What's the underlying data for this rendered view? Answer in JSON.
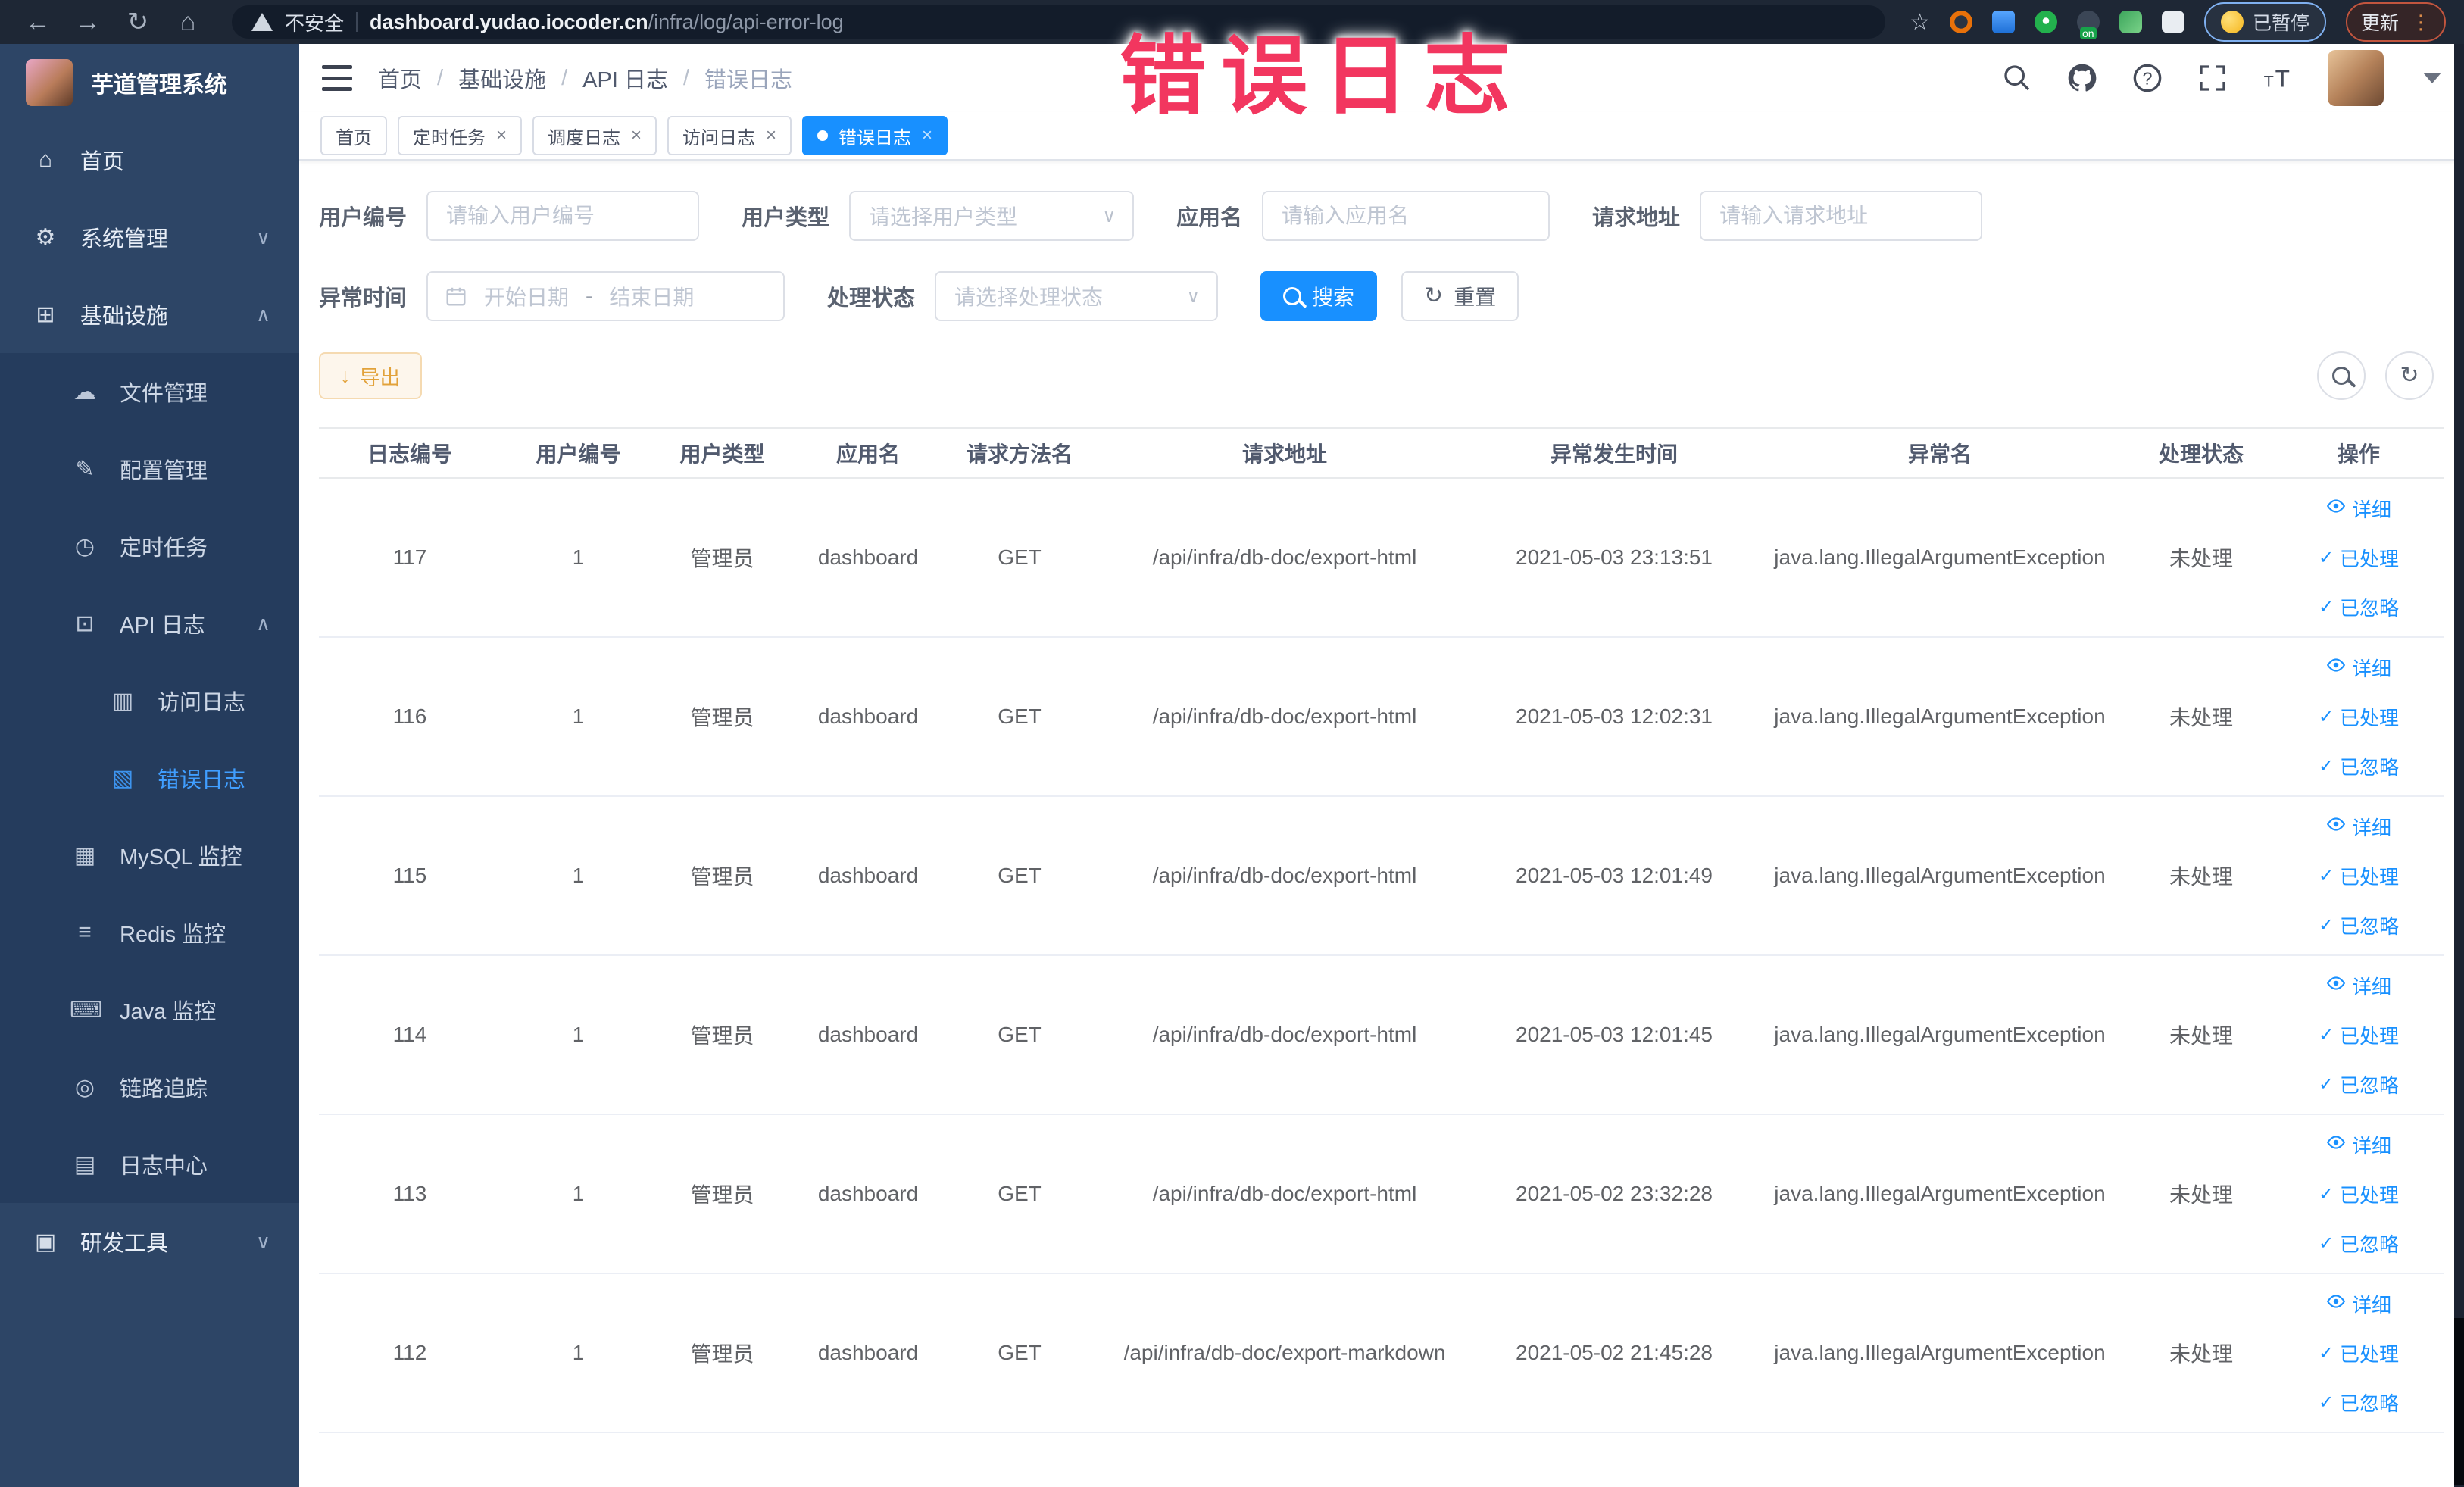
{
  "browser": {
    "security_label": "不安全",
    "url_domain": "dashboard.yudao.iocoder.cn",
    "url_path": "/infra/log/api-error-log",
    "extension_badge": "on",
    "paused_badge": "已暂停",
    "update_button": "更新"
  },
  "annotation": {
    "text": "错误日志",
    "color": "#f2365f"
  },
  "sidebar": {
    "logo_title": "芋道管理系统",
    "items": [
      {
        "label": "首页",
        "level": 1,
        "icon": "home"
      },
      {
        "label": "系统管理",
        "level": 1,
        "icon": "gear",
        "chevron": "down"
      },
      {
        "label": "基础设施",
        "level": 1,
        "icon": "infrastructure",
        "chevron": "up"
      },
      {
        "label": "文件管理",
        "level": 2,
        "icon": "file-manage",
        "submenu": true
      },
      {
        "label": "配置管理",
        "level": 2,
        "icon": "config-manage",
        "submenu": true
      },
      {
        "label": "定时任务",
        "level": 2,
        "icon": "timer-task",
        "submenu": true
      },
      {
        "label": "API 日志",
        "level": 2,
        "icon": "api-log",
        "chevron": "up",
        "submenu": true
      },
      {
        "label": "访问日志",
        "level": 3,
        "icon": "access-log",
        "submenu": true
      },
      {
        "label": "错误日志",
        "level": 3,
        "icon": "error-log",
        "submenu": true,
        "active": true
      },
      {
        "label": "MySQL 监控",
        "level": 2,
        "icon": "mysql-monitor",
        "submenu": true
      },
      {
        "label": "Redis 监控",
        "level": 2,
        "icon": "redis-monitor",
        "submenu": true
      },
      {
        "label": "Java 监控",
        "level": 2,
        "icon": "java-monitor",
        "submenu": true
      },
      {
        "label": "链路追踪",
        "level": 2,
        "icon": "trace",
        "submenu": true
      },
      {
        "label": "日志中心",
        "level": 2,
        "icon": "log-center",
        "submenu": true
      },
      {
        "label": "研发工具",
        "level": 1,
        "icon": "toolbox",
        "chevron": "down"
      }
    ]
  },
  "header": {
    "breadcrumbs": [
      "首页",
      "基础设施",
      "API 日志",
      "错误日志"
    ]
  },
  "tabs": [
    {
      "label": "首页",
      "closable": false,
      "active": false
    },
    {
      "label": "定时任务",
      "closable": true,
      "active": false
    },
    {
      "label": "调度日志",
      "closable": true,
      "active": false
    },
    {
      "label": "访问日志",
      "closable": true,
      "active": false
    },
    {
      "label": "错误日志",
      "closable": true,
      "active": true
    }
  ],
  "filters": {
    "user_no": {
      "label": "用户编号",
      "placeholder": "请输入用户编号"
    },
    "user_type": {
      "label": "用户类型",
      "placeholder": "请选择用户类型"
    },
    "app_name": {
      "label": "应用名",
      "placeholder": "请输入应用名"
    },
    "request_url": {
      "label": "请求地址",
      "placeholder": "请输入请求地址"
    },
    "exception_time": {
      "label": "异常时间",
      "start_placeholder": "开始日期",
      "separator": "-",
      "end_placeholder": "结束日期"
    },
    "process_status": {
      "label": "处理状态",
      "placeholder": "请选择处理状态"
    },
    "search_label": "搜索",
    "reset_label": "重置"
  },
  "toolbar": {
    "export_label": "导出"
  },
  "table": {
    "columns": [
      "日志编号",
      "用户编号",
      "用户类型",
      "应用名",
      "请求方法名",
      "请求地址",
      "异常发生时间",
      "异常名",
      "处理状态",
      "操作"
    ],
    "row_actions": [
      "详细",
      "已处理",
      "已忽略"
    ],
    "rows": [
      {
        "id": "117",
        "user_id": "1",
        "user_type": "管理员",
        "app": "dashboard",
        "method": "GET",
        "url": "/api/infra/db-doc/export-html",
        "time": "2021-05-03 23:13:51",
        "exception": "java.lang.IllegalArgumentException",
        "status": "未处理"
      },
      {
        "id": "116",
        "user_id": "1",
        "user_type": "管理员",
        "app": "dashboard",
        "method": "GET",
        "url": "/api/infra/db-doc/export-html",
        "time": "2021-05-03 12:02:31",
        "exception": "java.lang.IllegalArgumentException",
        "status": "未处理"
      },
      {
        "id": "115",
        "user_id": "1",
        "user_type": "管理员",
        "app": "dashboard",
        "method": "GET",
        "url": "/api/infra/db-doc/export-html",
        "time": "2021-05-03 12:01:49",
        "exception": "java.lang.IllegalArgumentException",
        "status": "未处理"
      },
      {
        "id": "114",
        "user_id": "1",
        "user_type": "管理员",
        "app": "dashboard",
        "method": "GET",
        "url": "/api/infra/db-doc/export-html",
        "time": "2021-05-03 12:01:45",
        "exception": "java.lang.IllegalArgumentException",
        "status": "未处理"
      },
      {
        "id": "113",
        "user_id": "1",
        "user_type": "管理员",
        "app": "dashboard",
        "method": "GET",
        "url": "/api/infra/db-doc/export-html",
        "time": "2021-05-02 23:32:28",
        "exception": "java.lang.IllegalArgumentException",
        "status": "未处理"
      },
      {
        "id": "112",
        "user_id": "1",
        "user_type": "管理员",
        "app": "dashboard",
        "method": "GET",
        "url": "/api/infra/db-doc/export-markdown",
        "time": "2021-05-02 21:45:28",
        "exception": "java.lang.IllegalArgumentException",
        "status": "未处理"
      }
    ]
  },
  "colors": {
    "accent": "#1890ff",
    "sidebar_bg": "#2d4566",
    "submenu_bg": "#253c5d",
    "annotation_red": "#f2365f",
    "export_orange": "#e6a23c"
  }
}
